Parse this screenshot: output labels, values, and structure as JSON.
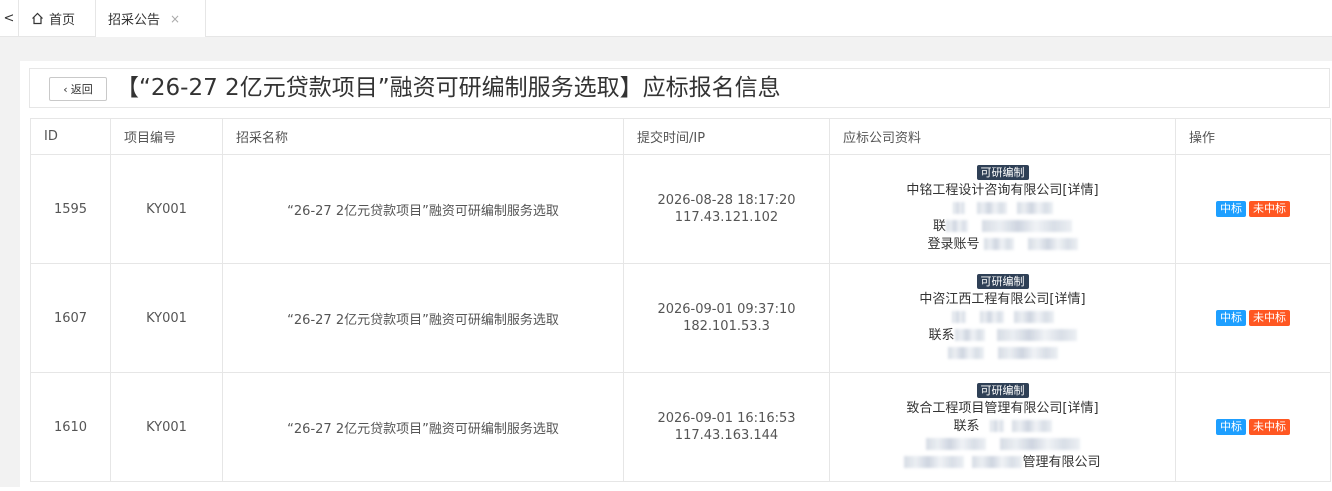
{
  "tabs": {
    "back_glyph": "<",
    "home_label": "首页",
    "active_label": "招采公告",
    "close_glyph": "×"
  },
  "header": {
    "back_label": "返回",
    "title": "【“26-27 2亿元贷款项目”融资可研编制服务选取】应标报名信息"
  },
  "table": {
    "columns": [
      "ID",
      "项目编号",
      "招采名称",
      "提交时间/IP",
      "应标公司资料",
      "操作"
    ],
    "rows": [
      {
        "id": "1595",
        "code": "KY001",
        "name": "“26-27 2亿元贷款项目”融资可研编制服务选取",
        "time": "2026-08-28 18:17:20",
        "ip": "117.43.121.102",
        "tag": "可研编制",
        "company": "中铭工程设计咨询有限公司[详情]",
        "contact_prefix": "联",
        "extra_prefix": "登录账号",
        "win_label": "中标",
        "lose_label": "未中标"
      },
      {
        "id": "1607",
        "code": "KY001",
        "name": "“26-27 2亿元贷款项目”融资可研编制服务选取",
        "time": "2026-09-01 09:37:10",
        "ip": "182.101.53.3",
        "tag": "可研编制",
        "company": "中咨江西工程有限公司[详情]",
        "contact_prefix": "联系",
        "extra_prefix": "",
        "win_label": "中标",
        "lose_label": "未中标"
      },
      {
        "id": "1610",
        "code": "KY001",
        "name": "“26-27 2亿元贷款项目”融资可研编制服务选取",
        "time": "2026-09-01 16:16:53",
        "ip": "117.43.163.144",
        "tag": "可研编制",
        "company": "致合工程项目管理有限公司[详情]",
        "contact_prefix": "联系",
        "extra_prefix": "管理有限公司",
        "win_label": "中标",
        "lose_label": "未中标"
      }
    ]
  },
  "colors": {
    "tag_bg": "#2f4056",
    "win_bg": "#1e9fff",
    "lose_bg": "#ff5722"
  }
}
